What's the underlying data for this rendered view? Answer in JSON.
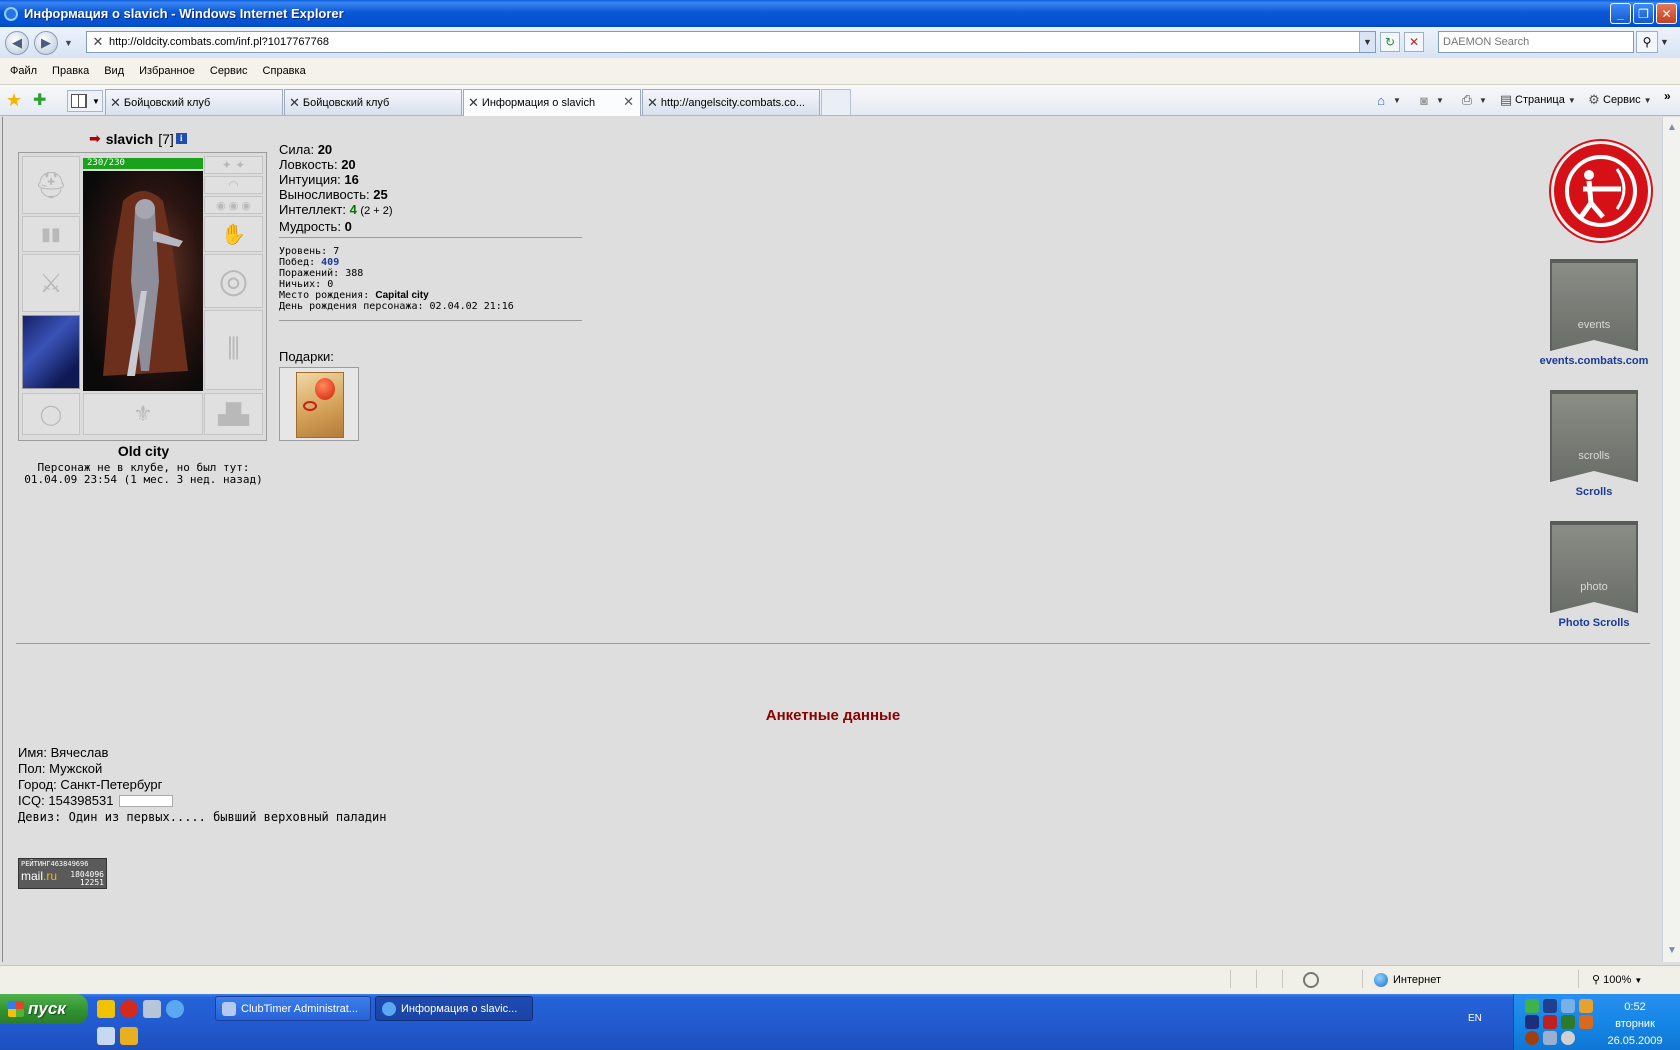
{
  "window": {
    "title": "Информация о slavich - Windows Internet Explorer"
  },
  "addressbar": {
    "url": "http://oldcity.combats.com/inf.pl?1017767768",
    "search_placeholder": "DAEMON Search"
  },
  "menu": [
    "Файл",
    "Правка",
    "Вид",
    "Избранное",
    "Сервис",
    "Справка"
  ],
  "tabs": [
    {
      "label": "Бойцовский клуб",
      "active": false
    },
    {
      "label": "Бойцовский клуб",
      "active": false
    },
    {
      "label": "Информация о slavich",
      "active": true
    },
    {
      "label": "http://angelscity.combats.co...",
      "active": false
    }
  ],
  "command_bar": {
    "page_label": "Страница",
    "tools_label": "Сервис"
  },
  "character": {
    "name": "slavich",
    "level": "[7]",
    "hp": "230/230",
    "city": "Old city",
    "status_line1": "Персонаж не в клубе, но был тут:",
    "status_line2": "01.04.09 23:54 (1 мес. 3 нед. назад)"
  },
  "stats": {
    "strength_label": "Сила:",
    "strength": "20",
    "agility_label": "Ловкость:",
    "agility": "20",
    "intuition_label": "Интуиция:",
    "intuition": "16",
    "endurance_label": "Выносливость:",
    "endurance": "25",
    "intellect_label": "Интеллект:",
    "intellect": "4",
    "intellect_extra": "(2 + 2)",
    "wisdom_label": "Мудрость:",
    "wisdom": "0"
  },
  "record": {
    "level_label": "Уровень:",
    "level": "7",
    "wins_label": "Побед:",
    "wins": "409",
    "losses_label": "Поражений:",
    "losses": "388",
    "draws_label": "Ничьих:",
    "draws": "0",
    "birthplace_label": "Место рождения:",
    "birthplace": "Capital city",
    "birthday_label": "День рождения персонажа:",
    "birthday": "02.04.02 21:16"
  },
  "gifts_label": "Подарки:",
  "side_links": {
    "events": "events.combats.com",
    "events_banner": "events",
    "scrolls": "Scrolls",
    "scrolls_banner": "scrolls",
    "photo": "Photo Scrolls",
    "photo_banner": "photo"
  },
  "anketa": {
    "title": "Анкетные данные",
    "name_label": "Имя:",
    "name": "Вячеслав",
    "gender_label": "Пол:",
    "gender": "Мужской",
    "city_label": "Город:",
    "city": "Санкт-Петербург",
    "icq_label": "ICQ:",
    "icq": "154398531",
    "motto_label": "Девиз:",
    "motto": "Один из первых..... бывший верховный паладин"
  },
  "mailru_counter": {
    "header": "РЕЙТИНГ463849696",
    "logo_main": "mail",
    "logo_suffix": ".ru",
    "line1": "1804096",
    "line2": "12251"
  },
  "statusbar": {
    "zone": "Интернет",
    "zoom": "100%"
  },
  "taskbar": {
    "start": "пуск",
    "buttons": [
      {
        "label": "ClubTimer Administrat...",
        "active": false
      },
      {
        "label": "Информация о slavic...",
        "active": true
      }
    ],
    "lang": "EN",
    "time": "0:52",
    "weekday": "вторник",
    "date": "26.05.2009"
  },
  "colors": {
    "title_blue": "#0452cf",
    "page_bg": "#dedede",
    "heading_red": "#8b0000",
    "link_blue": "#1a3a9a",
    "hp_green": "#1ba21b"
  }
}
